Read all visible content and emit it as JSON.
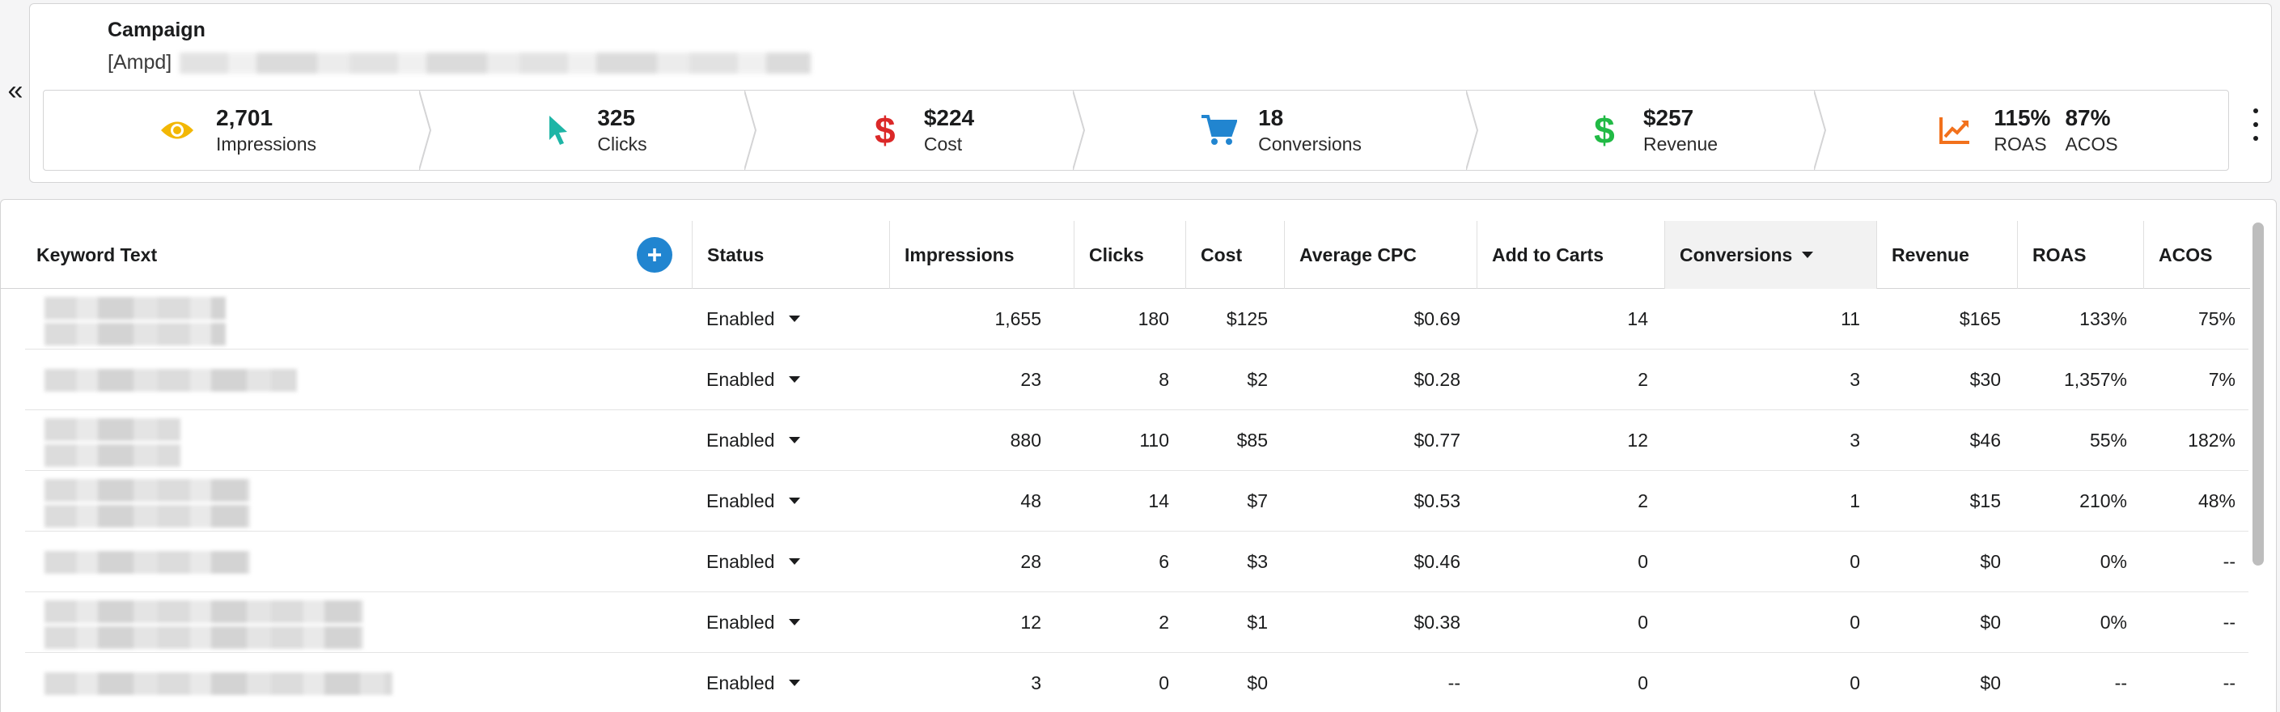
{
  "campaign": {
    "heading": "Campaign",
    "name_prefix": "[Ampd]"
  },
  "metrics": [
    {
      "icon": "eye-icon",
      "color": "#f2b705",
      "value": "2,701",
      "label": "Impressions"
    },
    {
      "icon": "cursor-icon",
      "color": "#1eb5a6",
      "value": "325",
      "label": "Clicks"
    },
    {
      "icon": "dollar-icon",
      "color": "#db2828",
      "value": "$224",
      "label": "Cost"
    },
    {
      "icon": "cart-icon",
      "color": "#2185d0",
      "value": "18",
      "label": "Conversions"
    },
    {
      "icon": "dollar-icon",
      "color": "#21ba45",
      "value": "$257",
      "label": "Revenue"
    },
    {
      "icon": "trend-chart-icon",
      "color": "#f2711c",
      "value": "115%",
      "label": "ROAS",
      "value2": "87%",
      "label2": "ACOS"
    }
  ],
  "table": {
    "columns": [
      "Keyword Text",
      "Status",
      "Impressions",
      "Clicks",
      "Cost",
      "Average CPC",
      "Add to Carts",
      "Conversions",
      "Revenue",
      "ROAS",
      "ACOS"
    ],
    "sorted_column": "Conversions",
    "rows": [
      {
        "status": "Enabled",
        "impressions": "1,655",
        "clicks": "180",
        "cost": "$125",
        "cpc": "$0.69",
        "atc": "14",
        "conversions": "11",
        "revenue": "$165",
        "roas": "133%",
        "acos": "75%"
      },
      {
        "status": "Enabled",
        "impressions": "23",
        "clicks": "8",
        "cost": "$2",
        "cpc": "$0.28",
        "atc": "2",
        "conversions": "3",
        "revenue": "$30",
        "roas": "1,357%",
        "acos": "7%"
      },
      {
        "status": "Enabled",
        "impressions": "880",
        "clicks": "110",
        "cost": "$85",
        "cpc": "$0.77",
        "atc": "12",
        "conversions": "3",
        "revenue": "$46",
        "roas": "55%",
        "acos": "182%"
      },
      {
        "status": "Enabled",
        "impressions": "48",
        "clicks": "14",
        "cost": "$7",
        "cpc": "$0.53",
        "atc": "2",
        "conversions": "1",
        "revenue": "$15",
        "roas": "210%",
        "acos": "48%"
      },
      {
        "status": "Enabled",
        "impressions": "28",
        "clicks": "6",
        "cost": "$3",
        "cpc": "$0.46",
        "atc": "0",
        "conversions": "0",
        "revenue": "$0",
        "roas": "0%",
        "acos": "--"
      },
      {
        "status": "Enabled",
        "impressions": "12",
        "clicks": "2",
        "cost": "$1",
        "cpc": "$0.38",
        "atc": "0",
        "conversions": "0",
        "revenue": "$0",
        "roas": "0%",
        "acos": "--"
      },
      {
        "status": "Enabled",
        "impressions": "3",
        "clicks": "0",
        "cost": "$0",
        "cpc": "--",
        "atc": "0",
        "conversions": "0",
        "revenue": "$0",
        "roas": "--",
        "acos": "--"
      }
    ]
  }
}
